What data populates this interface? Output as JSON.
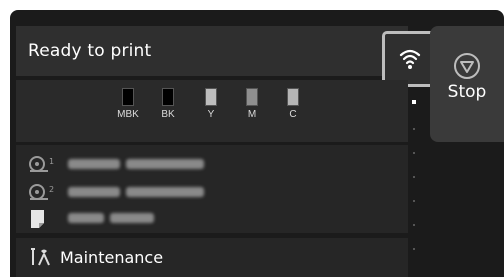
{
  "header": {
    "title": "Ready to print",
    "wifi_icon": "wifi-icon"
  },
  "stop": {
    "label": "Stop",
    "icon": "stop-circle-icon"
  },
  "inks": [
    {
      "label": "MBK",
      "color": "#000000"
    },
    {
      "label": "BK",
      "color": "#000000"
    },
    {
      "label": "Y",
      "color": "#bdbdbd"
    },
    {
      "label": "M",
      "color": "#8f8f8f"
    },
    {
      "label": "C",
      "color": "#b5b5b5"
    }
  ],
  "media": [
    {
      "icon": "roll-1-icon"
    },
    {
      "icon": "roll-2-icon"
    },
    {
      "icon": "cut-sheet-icon"
    }
  ],
  "maintenance": {
    "label": "Maintenance",
    "icon": "maintenance-tools-icon"
  },
  "colors": {
    "screen_bg": "#1b1b1b",
    "panel_bg": "#2f2f2f",
    "highlight_border": "#bdbdbd"
  }
}
